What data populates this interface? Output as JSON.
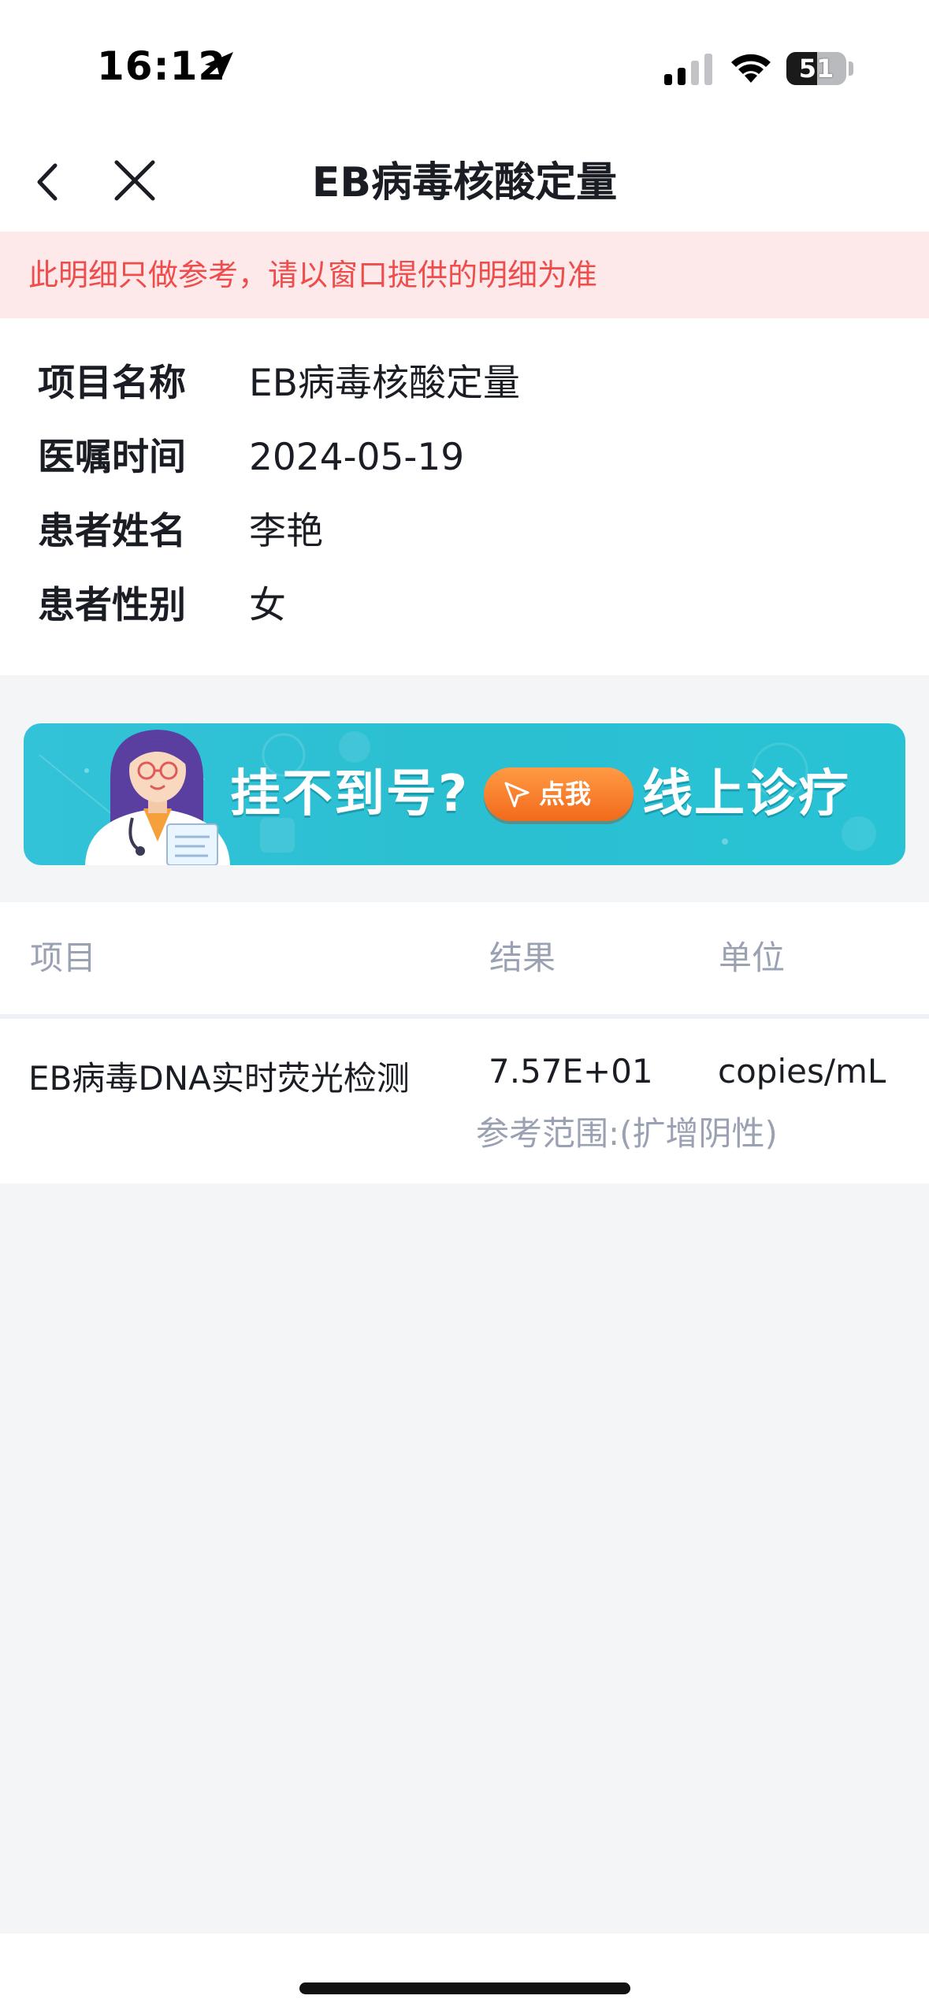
{
  "status_bar": {
    "time": "16:12",
    "battery": "51",
    "battery_level": 0.51,
    "icons": [
      "location-arrow-icon",
      "cellular-signal-icon",
      "wifi-icon",
      "battery-icon"
    ]
  },
  "nav": {
    "title": "EB病毒核酸定量",
    "back_icon": "chevron-left-icon",
    "close_icon": "close-icon"
  },
  "notice": {
    "text": "此明细只做参考，请以窗口提供的明细为准",
    "color": "#ef4c4c",
    "background": "#fde9e9"
  },
  "info": {
    "rows": [
      {
        "label": "项目名称",
        "value": "EB病毒核酸定量"
      },
      {
        "label": "医嘱时间",
        "value": "2024-05-19"
      },
      {
        "label": "患者姓名",
        "value": "李艳"
      },
      {
        "label": "患者性别",
        "value": "女"
      }
    ]
  },
  "banner": {
    "headline": "挂不到号?",
    "button_label": "点我",
    "tail": "线上诊疗",
    "accent": "#2bbfd2",
    "button_color": "#f26a1c"
  },
  "table": {
    "headers": {
      "item": "项目",
      "result": "结果",
      "unit": "单位"
    },
    "rows": [
      {
        "name": "EB病毒DNA实时荧光检测",
        "result": "7.57E+01",
        "unit": "copies/mL",
        "reference": "参考范围:(扩增阴性)"
      }
    ]
  }
}
